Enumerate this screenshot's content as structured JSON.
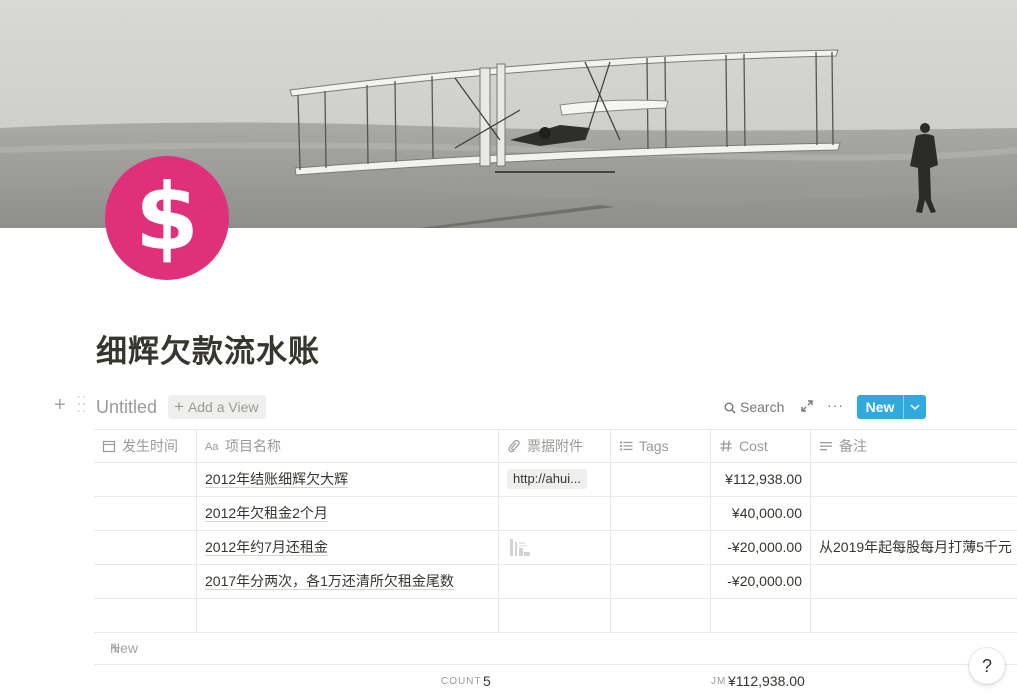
{
  "page": {
    "title": "细辉欠款流水账",
    "icon": "dollar-sign-icon",
    "cover": "wright-flyer-photo"
  },
  "colors": {
    "accent": "#2eaadc",
    "icon_bg": "#e0307a",
    "text": "#37352f",
    "muted": "#9b9a97"
  },
  "toolbar": {
    "view_title": "Untitled",
    "add_view_label": "Add a View",
    "search_label": "Search",
    "more_label": "···",
    "new_label": "New"
  },
  "table": {
    "columns": [
      {
        "label": "发生时间",
        "icon": "calendar-icon"
      },
      {
        "label": "项目名称",
        "icon": "text-title-icon"
      },
      {
        "label": "票据附件",
        "icon": "paperclip-icon"
      },
      {
        "label": "Tags",
        "icon": "list-icon"
      },
      {
        "label": "Cost",
        "icon": "hash-icon"
      },
      {
        "label": "备注",
        "icon": "text-lines-icon"
      }
    ],
    "rows": [
      {
        "date": "",
        "name": "2012年结账细辉欠大辉",
        "attachment": "http://ahui...",
        "tags": "",
        "cost": "¥112,938.00",
        "note": ""
      },
      {
        "date": "",
        "name": "2012年欠租金2个月",
        "attachment": "",
        "tags": "",
        "cost": "¥40,000.00",
        "note": ""
      },
      {
        "date": "",
        "name": "2012年约7月还租金",
        "attachment": "thumbnail",
        "tags": "",
        "cost": "-¥20,000.00",
        "note": "从2019年起每股每月打薄5千元"
      },
      {
        "date": "",
        "name": "2017年分两次，各1万还清所欠租金尾数",
        "attachment": "",
        "tags": "",
        "cost": "-¥20,000.00",
        "note": ""
      },
      {
        "date": "",
        "name": "",
        "attachment": "",
        "tags": "",
        "cost": "",
        "note": ""
      }
    ],
    "new_row_label": "New",
    "footer": {
      "count_label": "COUNT",
      "count_value": "5",
      "sum_label": "JM",
      "sum_value": "¥112,938.00"
    }
  },
  "help_label": "?"
}
